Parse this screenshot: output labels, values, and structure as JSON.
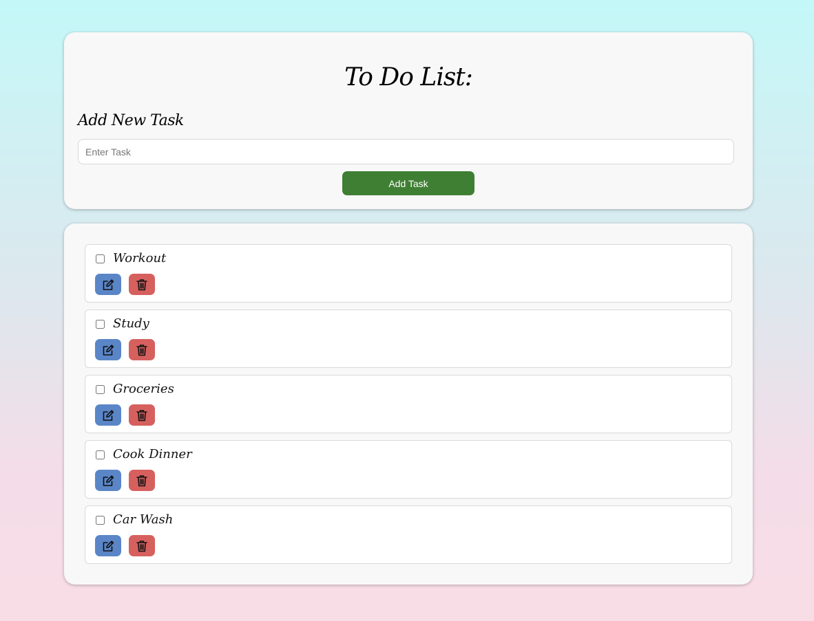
{
  "header": {
    "title": "To Do List:",
    "subtitle": "Add New Task",
    "input_placeholder": "Enter Task",
    "input_value": "",
    "add_button_label": "Add Task"
  },
  "tasks": [
    {
      "label": "Workout",
      "checked": false
    },
    {
      "label": "Study",
      "checked": false
    },
    {
      "label": "Groceries",
      "checked": false
    },
    {
      "label": "Cook Dinner",
      "checked": false
    },
    {
      "label": "Car Wash",
      "checked": false
    }
  ],
  "icons": {
    "edit": "pencil-square-icon",
    "delete": "trash-icon"
  },
  "colors": {
    "add_button": "#3f7f33",
    "edit_button": "#5a86c8",
    "delete_button": "#d6605e"
  }
}
